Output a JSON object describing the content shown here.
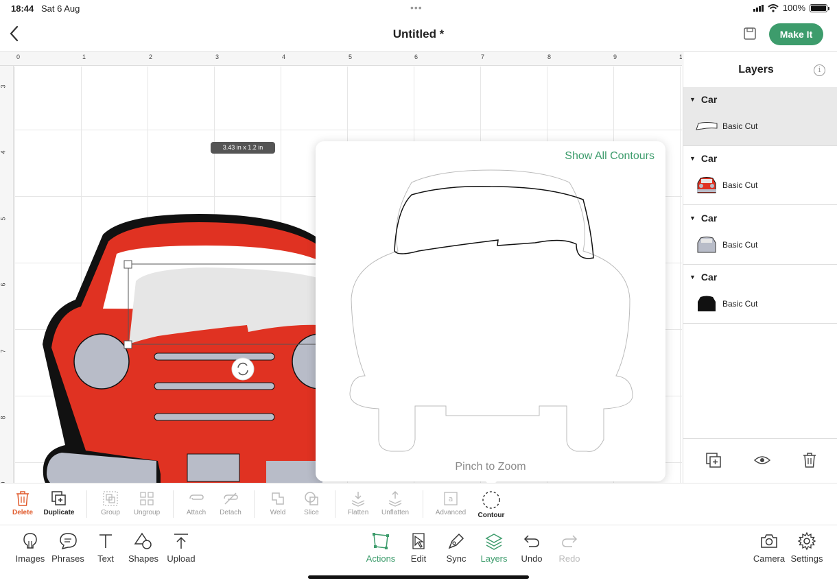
{
  "status": {
    "time": "18:44",
    "date": "Sat 6 Aug",
    "battery": "100%"
  },
  "header": {
    "title": "Untitled *",
    "make_it": "Make It"
  },
  "canvas": {
    "ruler_top": [
      "0",
      "1",
      "2",
      "3",
      "4",
      "5",
      "6",
      "7",
      "8",
      "9",
      "1"
    ],
    "ruler_left": [
      "3",
      "4",
      "5",
      "6",
      "7",
      "8",
      "9"
    ],
    "dimension": "3.43 in x 1.2 in"
  },
  "contour_popup": {
    "show_all": "Show All Contours",
    "pinch": "Pinch to Zoom"
  },
  "layers": {
    "title": "Layers",
    "groups": [
      {
        "name": "Car",
        "item": "Basic Cut"
      },
      {
        "name": "Car",
        "item": "Basic Cut"
      },
      {
        "name": "Car",
        "item": "Basic Cut"
      },
      {
        "name": "Car",
        "item": "Basic Cut"
      }
    ]
  },
  "actions_toolbar": {
    "delete": "Delete",
    "duplicate": "Duplicate",
    "group": "Group",
    "ungroup": "Ungroup",
    "attach": "Attach",
    "detach": "Detach",
    "weld": "Weld",
    "slice": "Slice",
    "flatten": "Flatten",
    "unflatten": "Unflatten",
    "advanced": "Advanced",
    "contour": "Contour"
  },
  "main_toolbar": {
    "images": "Images",
    "phrases": "Phrases",
    "text": "Text",
    "shapes": "Shapes",
    "upload": "Upload",
    "actions": "Actions",
    "edit": "Edit",
    "sync": "Sync",
    "layers": "Layers",
    "undo": "Undo",
    "redo": "Redo",
    "camera": "Camera",
    "settings": "Settings"
  },
  "colors": {
    "accent": "#3d9c6c",
    "car_red": "#e03222",
    "car_grey": "#b8bcc8",
    "delete": "#e05a2b"
  }
}
